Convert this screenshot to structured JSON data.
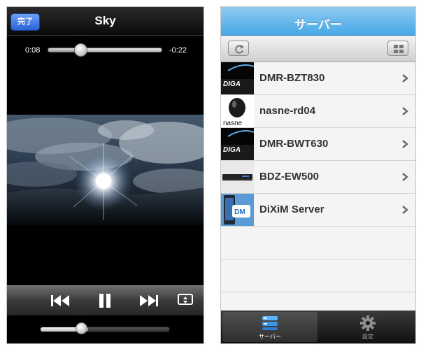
{
  "player": {
    "done_label": "完了",
    "title": "Sky",
    "elapsed": "0:08",
    "remaining": "-0:22",
    "progress": 0.27,
    "volume": 0.37
  },
  "server": {
    "title": "サーバー",
    "items": [
      {
        "name": "DMR-BZT830",
        "thumb": "diga-logo"
      },
      {
        "name": "nasne-rd04",
        "thumb": "nasne-logo"
      },
      {
        "name": "DMR-BWT630",
        "thumb": "diga-logo"
      },
      {
        "name": "BDZ-EW500",
        "thumb": "recorder-device"
      },
      {
        "name": "DiXiM Server",
        "thumb": "dixim-logo"
      }
    ],
    "tabs": [
      {
        "label": "サーバー",
        "icon": "server-icon",
        "active": true
      },
      {
        "label": "設定",
        "icon": "gear-icon",
        "active": false
      }
    ],
    "accent": "#46a8e6"
  }
}
